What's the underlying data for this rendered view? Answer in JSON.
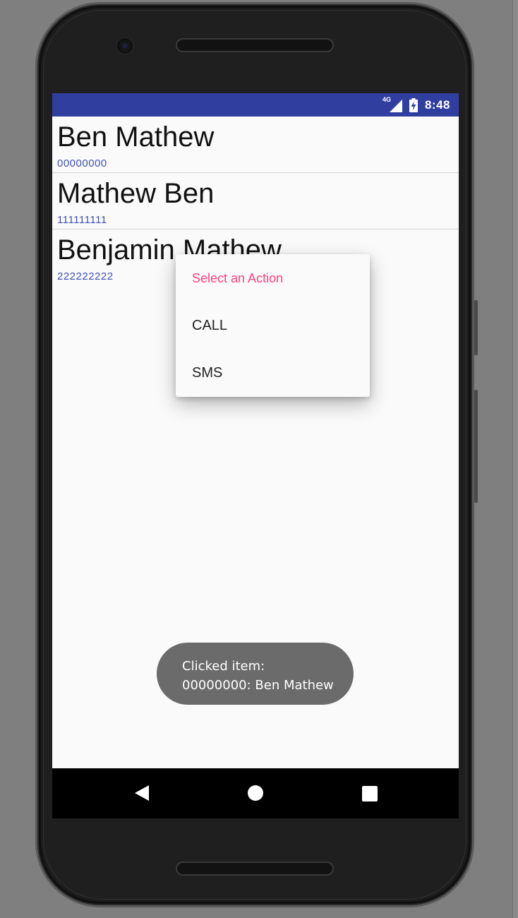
{
  "status_bar": {
    "network_label": "4G",
    "time": "8:48",
    "background_color": "#303f9f"
  },
  "contacts": [
    {
      "name": "Ben Mathew",
      "number": "00000000"
    },
    {
      "name": "Mathew Ben",
      "number": "111111111"
    },
    {
      "name": "Benjamin Mathew",
      "number": "222222222"
    }
  ],
  "context_menu": {
    "title": "Select an Action",
    "title_color": "#ff4081",
    "items": [
      {
        "label": "CALL"
      },
      {
        "label": "SMS"
      }
    ]
  },
  "toast": {
    "line1": "Clicked item:",
    "line2": "00000000: Ben Mathew"
  },
  "nav_bar": {
    "back_icon": "back-triangle",
    "home_icon": "home-circle",
    "recents_icon": "recents-square"
  },
  "colors": {
    "accent": "#ff4081",
    "primary": "#3f51b5",
    "primary_dark": "#303f9f"
  }
}
